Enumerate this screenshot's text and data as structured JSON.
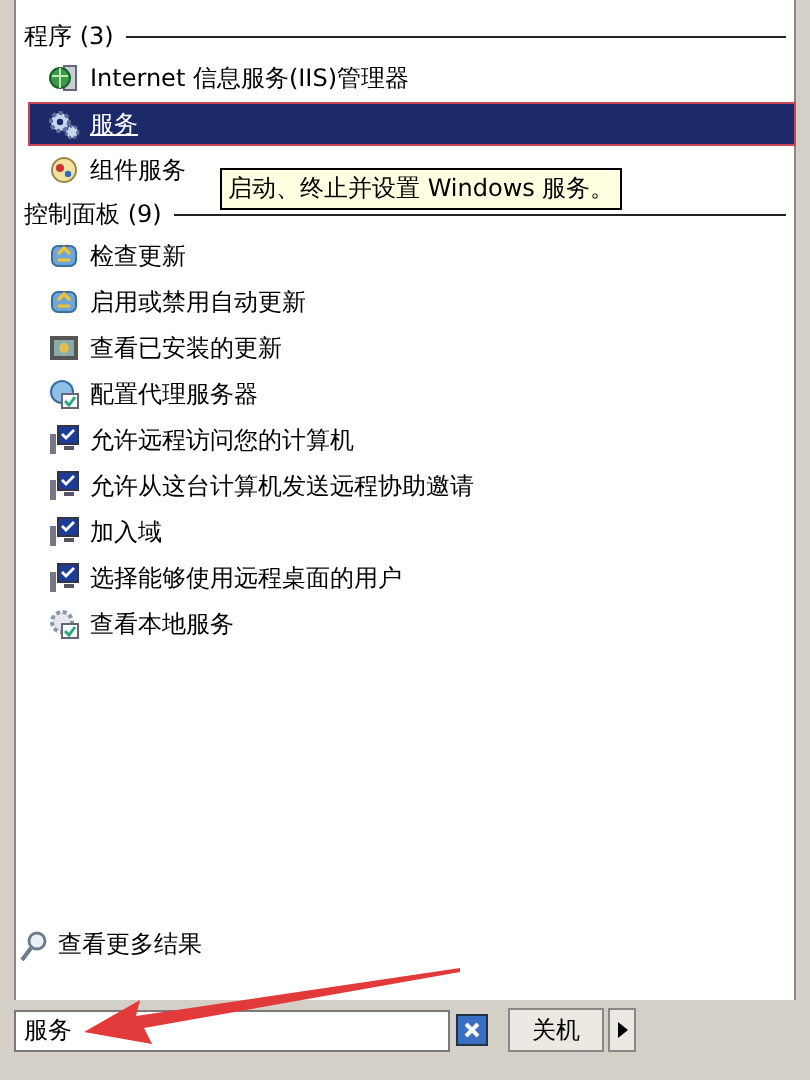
{
  "groups": [
    {
      "heading": "程序 (3)",
      "items": [
        {
          "label": "Internet 信息服务(IIS)管理器",
          "kind": "iis",
          "selected": false
        },
        {
          "label": "服务",
          "kind": "gear",
          "selected": true
        },
        {
          "label": "组件服务",
          "kind": "component",
          "selected": false
        }
      ]
    },
    {
      "heading": "控制面板 (9)",
      "items": [
        {
          "label": "检查更新",
          "kind": "update",
          "selected": false
        },
        {
          "label": "启用或禁用自动更新",
          "kind": "update",
          "selected": false
        },
        {
          "label": "查看已安装的更新",
          "kind": "installed",
          "selected": false
        },
        {
          "label": "配置代理服务器",
          "kind": "proxy",
          "selected": false
        },
        {
          "label": "允许远程访问您的计算机",
          "kind": "remote",
          "selected": false
        },
        {
          "label": "允许从这台计算机发送远程协助邀请",
          "kind": "remote",
          "selected": false
        },
        {
          "label": "加入域",
          "kind": "remote",
          "selected": false
        },
        {
          "label": "选择能够使用远程桌面的用户",
          "kind": "remote",
          "selected": false
        },
        {
          "label": "查看本地服务",
          "kind": "localservice",
          "selected": false
        }
      ]
    }
  ],
  "tooltip": "启动、终止并设置 Windows 服务。",
  "more_results": "查看更多结果",
  "search": {
    "value": "服务"
  },
  "shutdown": {
    "label": "关机"
  }
}
